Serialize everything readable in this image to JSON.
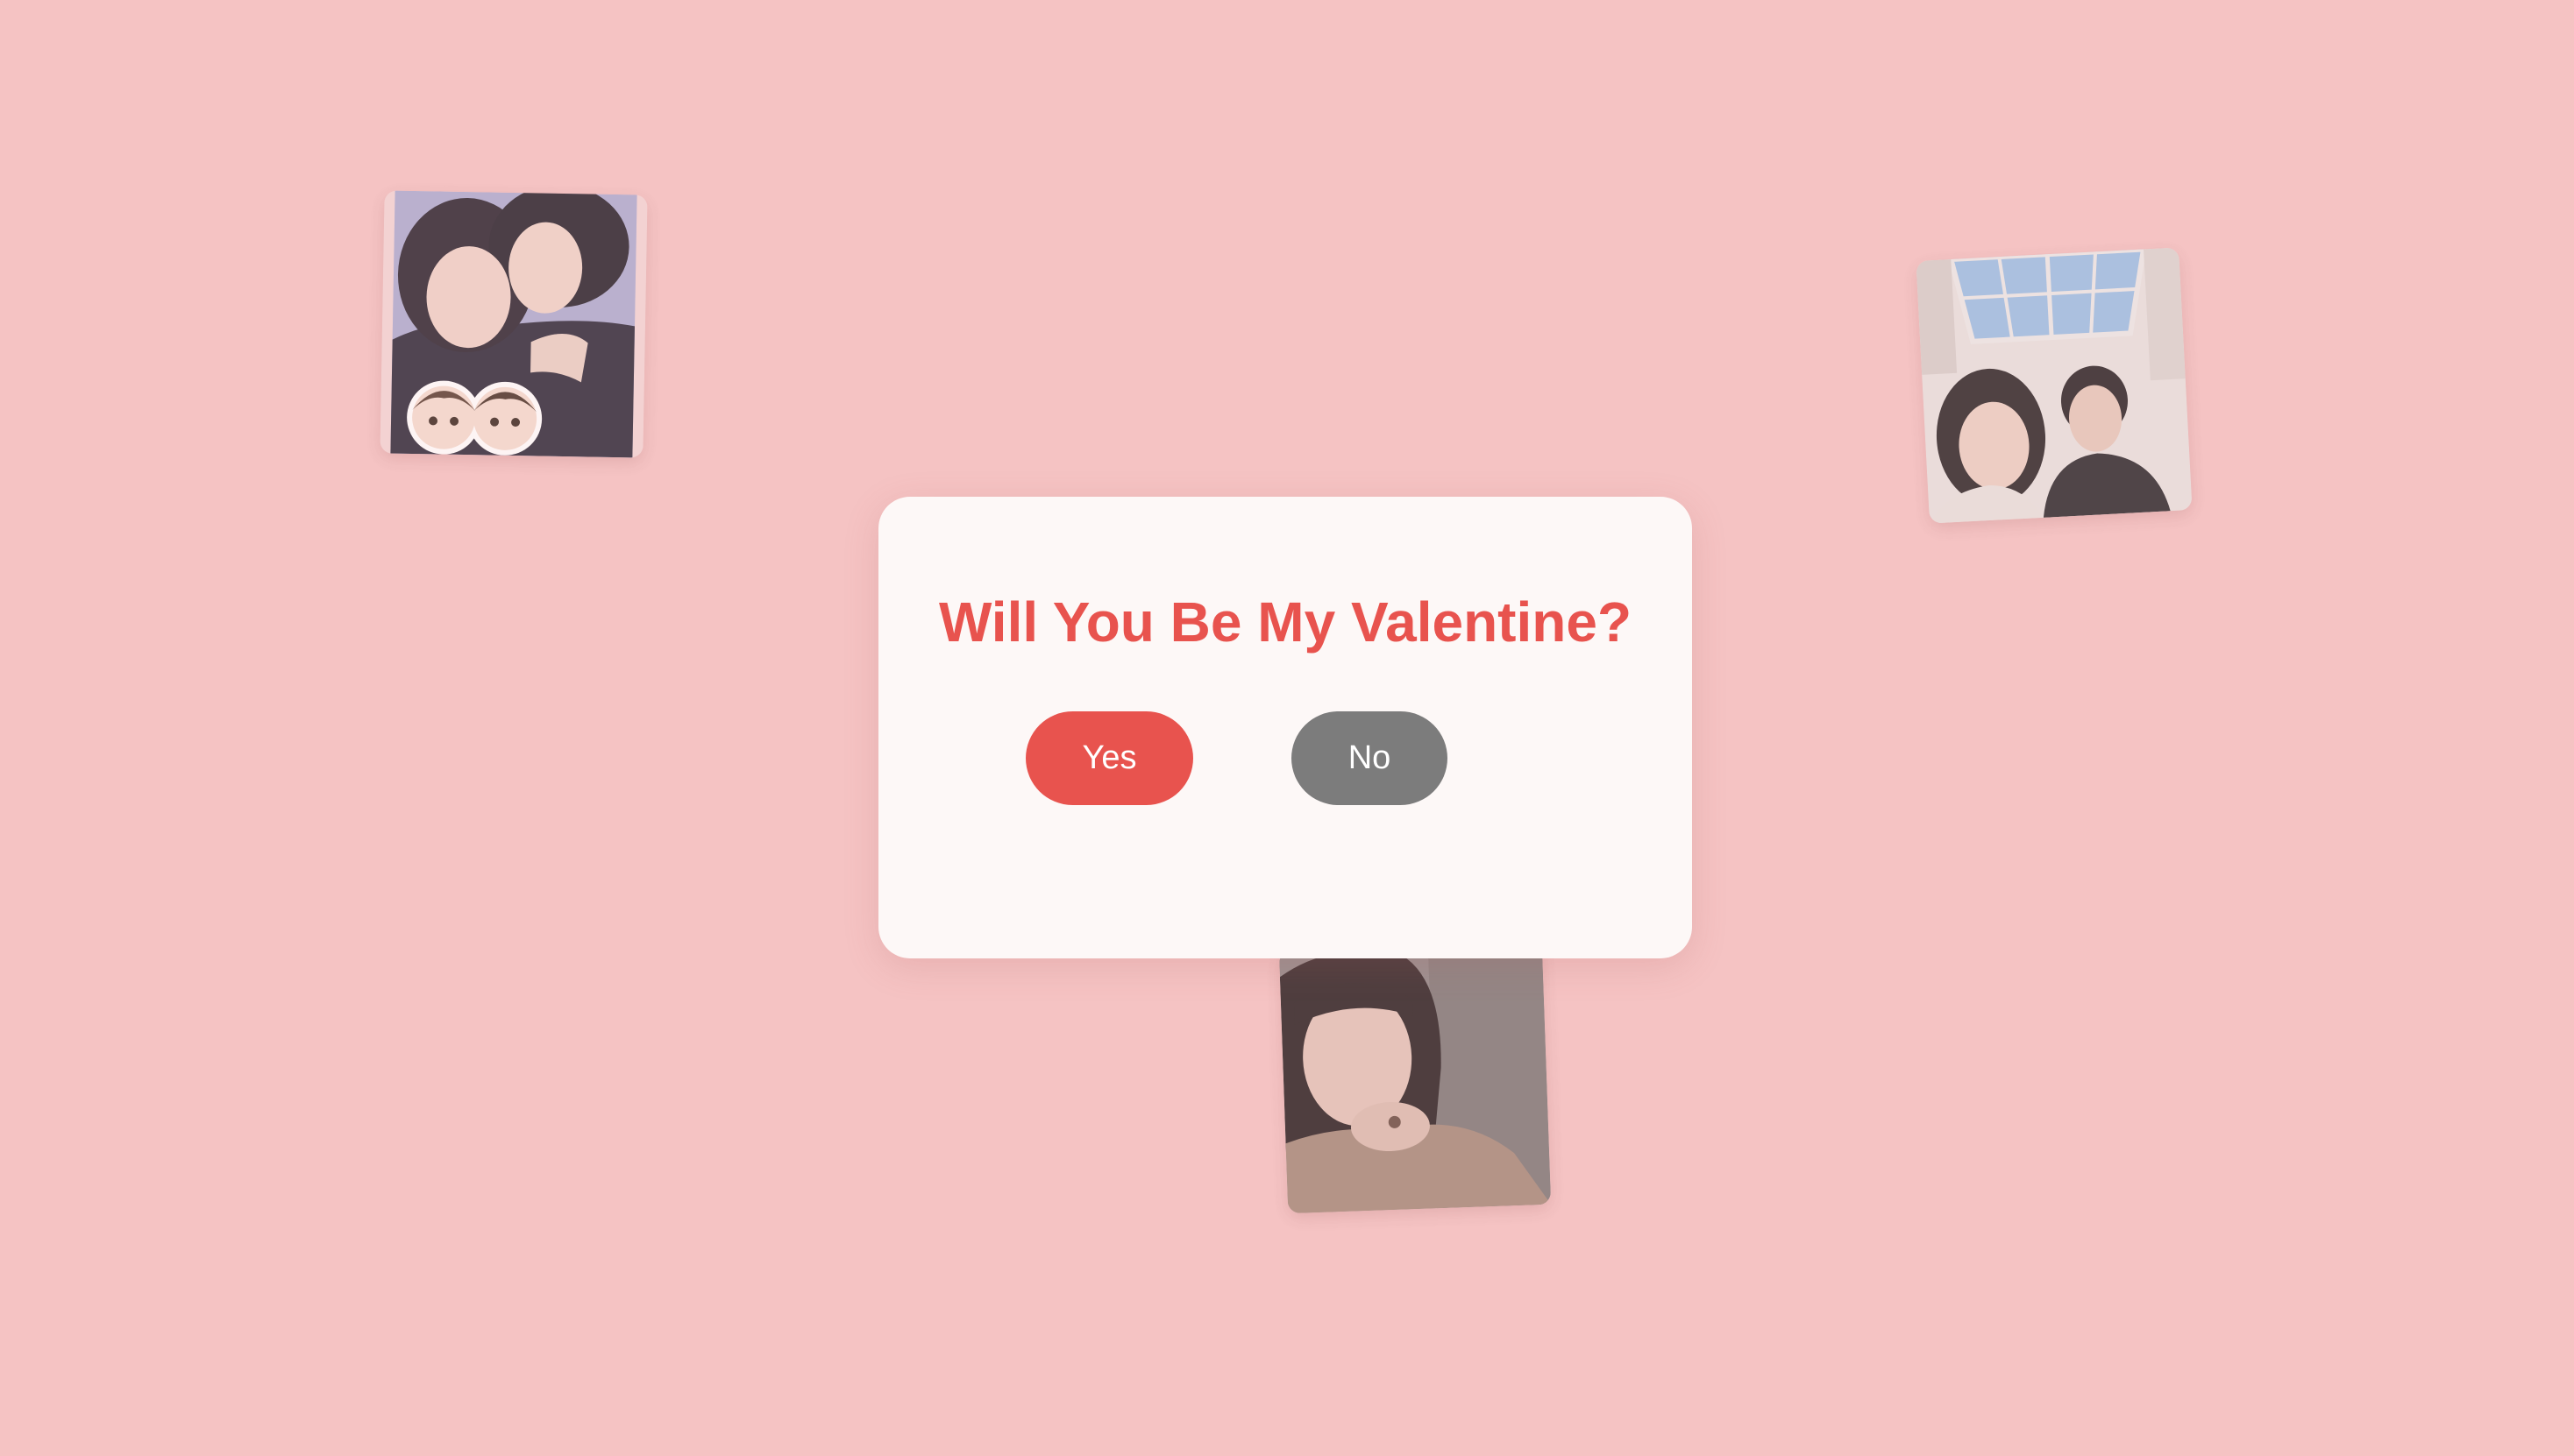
{
  "dialog": {
    "question": "Will You Be My Valentine?",
    "yes_label": "Yes",
    "no_label": "No"
  },
  "colors": {
    "background": "#f5c3c3",
    "card": "#fdf8f7",
    "accent": "#e8534e",
    "no_button": "#7c7c7c"
  }
}
